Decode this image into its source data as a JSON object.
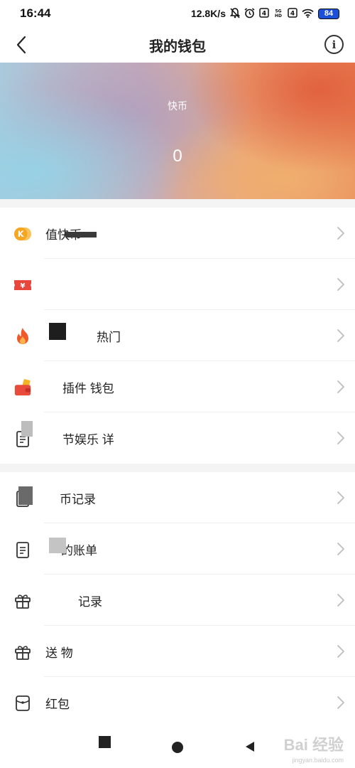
{
  "status_bar": {
    "time": "16:44",
    "network_speed": "12.8K/s",
    "icons": [
      "mute-bell-icon",
      "alarm-icon",
      "sim-4g-icon",
      "5g-hd-icon",
      "sim-4g-icon-2",
      "wifi-icon"
    ],
    "battery": "84"
  },
  "nav": {
    "title": "我的钱包",
    "back_icon": "chevron-left-icon",
    "info_icon": "info-icon",
    "info_glyph": "i"
  },
  "banner": {
    "label": "快币",
    "value": "0"
  },
  "section1": [
    {
      "icon": "kuaibi-coin-icon",
      "label": "值快币"
    },
    {
      "icon": "ticket-icon",
      "label": ""
    },
    {
      "icon": "fire-icon",
      "label": "热门"
    },
    {
      "icon": "wallet-icon",
      "label": "插件 钱包"
    },
    {
      "icon": "clipboard-icon",
      "label": "节娱乐 详"
    }
  ],
  "section2": [
    {
      "icon": "record-icon",
      "label": "币记录"
    },
    {
      "icon": "bill-icon",
      "label": "的账单"
    },
    {
      "icon": "gift-icon",
      "label": "记录"
    },
    {
      "icon": "gift-icon",
      "label": "送 物"
    },
    {
      "icon": "red-packet-icon",
      "label": "红包"
    }
  ],
  "watermark": {
    "text": "Bai 经验",
    "url": "jingyan.baidu.com"
  },
  "colors": {
    "accent_orange": "#f5a623",
    "red": "#e8453c"
  }
}
